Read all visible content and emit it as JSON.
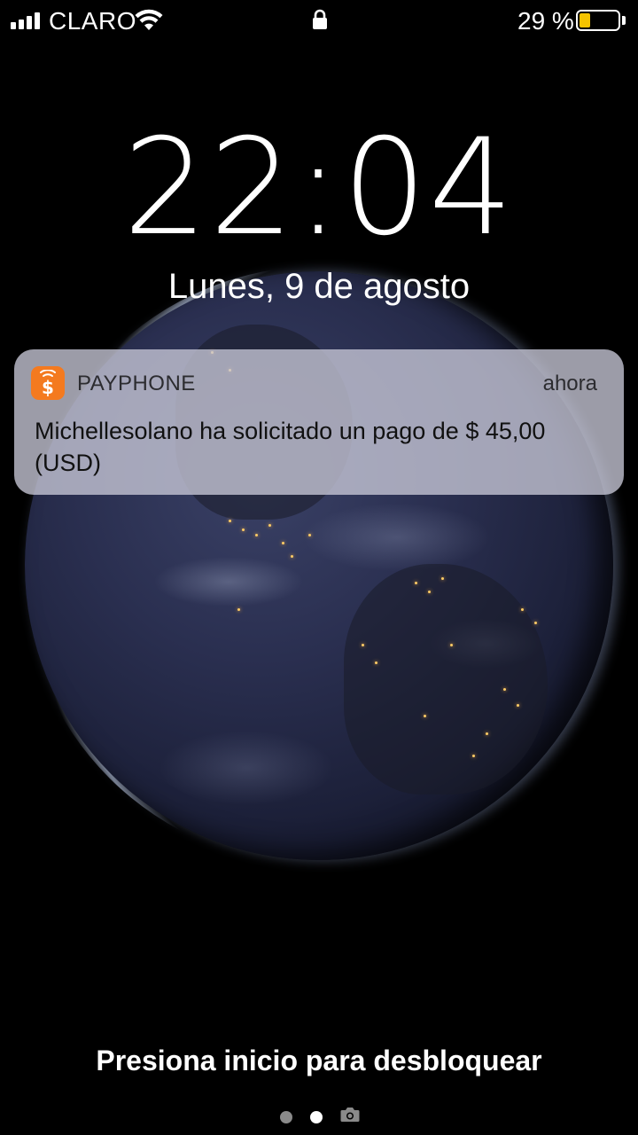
{
  "status_bar": {
    "carrier": "CLARO",
    "battery_percent_label": "29 %",
    "battery_level": 0.29,
    "battery_fill_color": "#f5c400",
    "icons": [
      "signal-icon",
      "wifi-icon",
      "lock-icon",
      "battery-icon"
    ]
  },
  "lock_screen": {
    "time": "22:04",
    "date": "Lunes, 9 de agosto",
    "unlock_hint": "Presiona inicio para desbloquear",
    "page_indicator": {
      "count": 2,
      "active_index": 1,
      "extra_icon": "camera-icon"
    }
  },
  "notification": {
    "app_name": "PAYPHONE",
    "app_icon": "payphone-dollar-icon",
    "app_icon_color": "#f47a1f",
    "time": "ahora",
    "message": "Michellesolano ha solicitado un pago de $ 45,00 (USD)"
  }
}
